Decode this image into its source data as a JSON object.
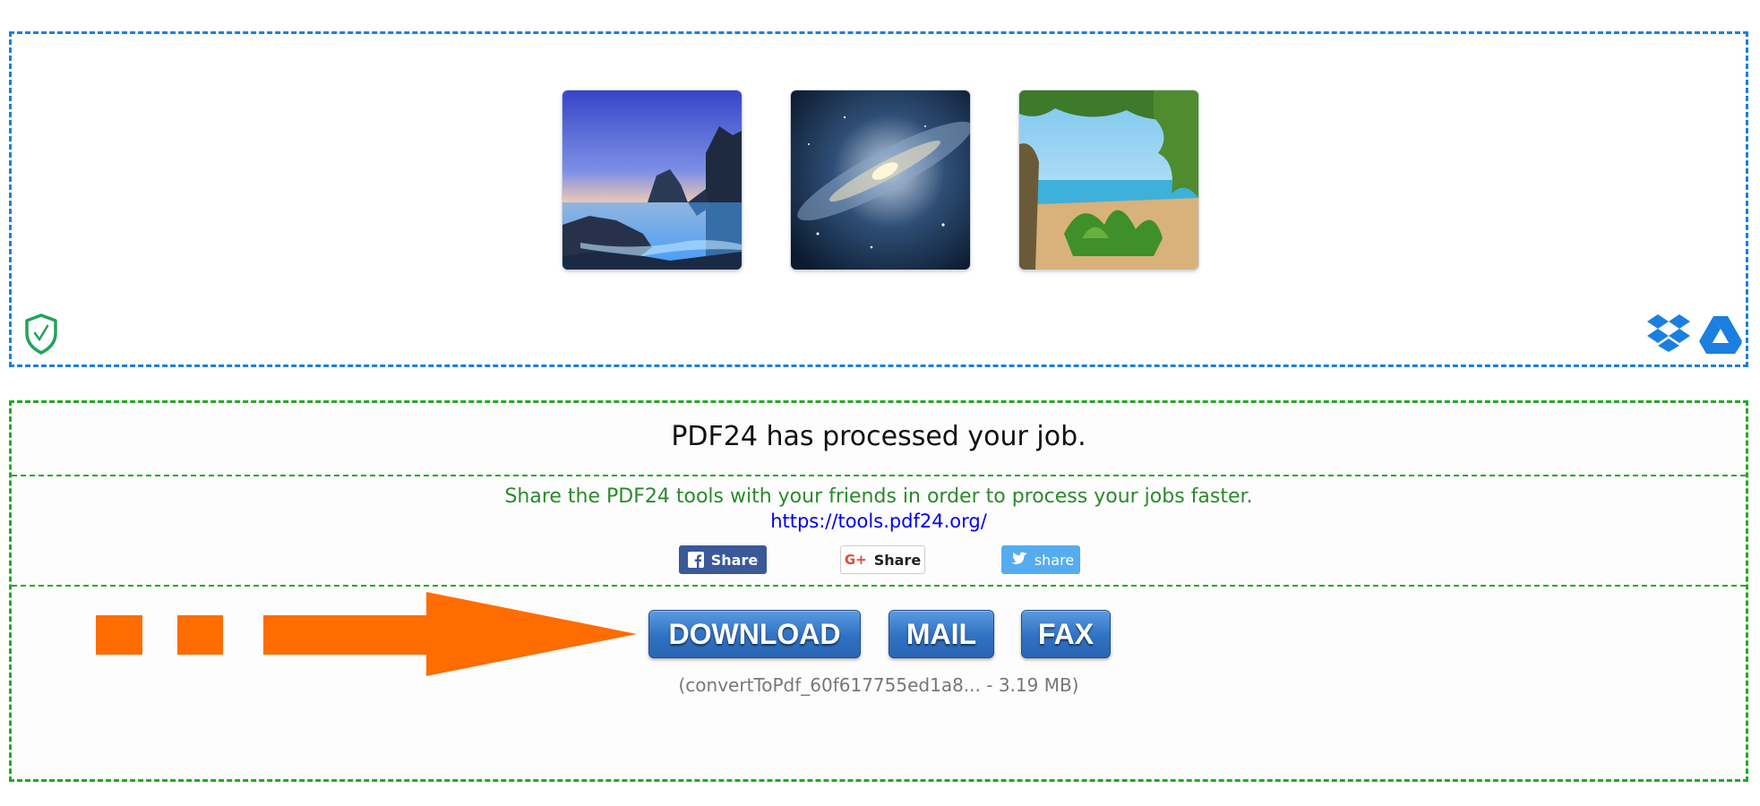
{
  "upload_area": {
    "thumbnails": [
      {
        "name": "Coastal rock at dusk"
      },
      {
        "name": "Galaxy"
      },
      {
        "name": "Tropical beach"
      }
    ],
    "security_icon": "shield-check-icon",
    "cloud_icons": [
      "dropbox-icon",
      "google-drive-icon"
    ]
  },
  "result": {
    "title": "PDF24 has processed your job.",
    "share_text": "Share the PDF24 tools with your friends in order to process your jobs faster.",
    "share_link": "https://tools.pdf24.org/",
    "social": {
      "facebook_label": "Share",
      "google_label": "Share",
      "twitter_label": "share"
    },
    "actions": {
      "download_label": "DOWNLOAD",
      "mail_label": "MAIL",
      "fax_label": "FAX"
    },
    "file_info": "(convertToPdf_60f617755ed1a8... - 3.19 MB)"
  },
  "colors": {
    "upload_border": "#1a7fe0",
    "result_border": "#22aa22",
    "button_blue": "#2f71c3",
    "arrow_orange": "#ff6c00"
  }
}
